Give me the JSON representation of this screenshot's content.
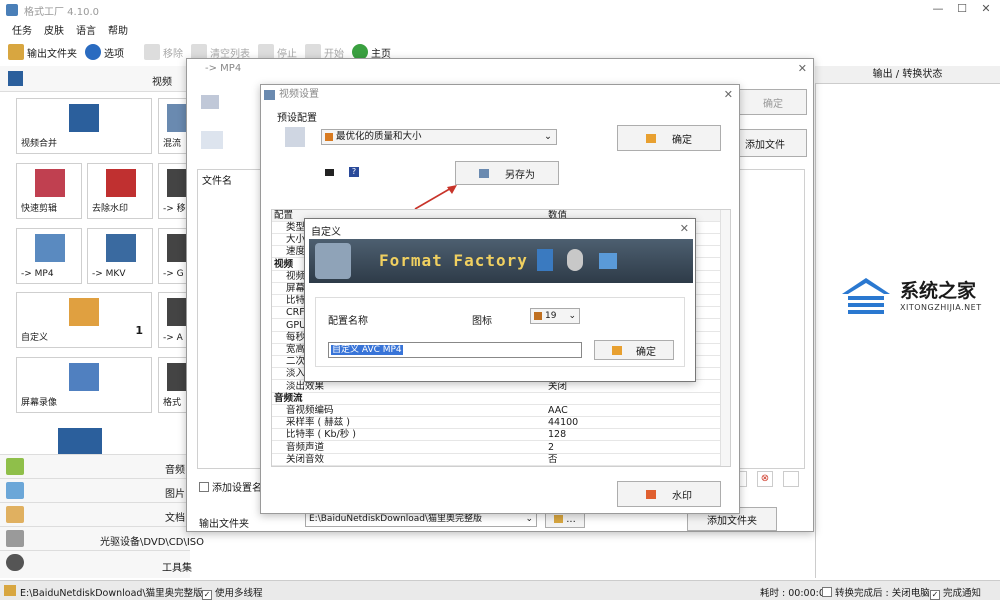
{
  "window": {
    "title": "格式工厂 4.10.0"
  },
  "menu": [
    "任务",
    "皮肤",
    "语言",
    "帮助"
  ],
  "toolbar": {
    "output_folder": "输出文件夹",
    "options": "选项",
    "remove": "移除",
    "clear_list": "清空列表",
    "stop": "停止",
    "start": "开始",
    "home": "主页"
  },
  "left_panel": {
    "header": "视频",
    "tiles": [
      {
        "label": "视频合并",
        "icon": "film-merge-icon"
      },
      {
        "label": "混流",
        "icon": "mux-icon"
      },
      {
        "label": "快速剪辑",
        "icon": "scissors-icon"
      },
      {
        "label": "去除水印",
        "icon": "eraser-icon"
      },
      {
        "label": "-> 移",
        "icon": "convert-icon"
      },
      {
        "label": "-> MP4",
        "icon": "mp4-file-icon"
      },
      {
        "label": "-> MKV",
        "icon": "mkv-file-icon"
      },
      {
        "label": "-> G",
        "icon": "convert-icon"
      },
      {
        "label": "自定义",
        "icon": "custom-icon",
        "badge": "1"
      },
      {
        "label": "-> A",
        "icon": "convert-icon"
      },
      {
        "label": "屏幕录像",
        "icon": "screen-record-icon"
      },
      {
        "label": "格式",
        "icon": "format-icon"
      }
    ],
    "categories": [
      "音频",
      "图片",
      "文档",
      "光驱设备\\DVD\\CD\\ISO",
      "工具集"
    ]
  },
  "right_panel": {
    "header": "输出 / 转换状态"
  },
  "status_bar": {
    "path": "E:\\BaiduNetdiskDownload\\猫里奥完整版",
    "multithread": "使用多线程",
    "elapsed": "耗时 : 00:00:00",
    "after_done": "转换完成后 : 关闭电脑",
    "notify": "完成通知"
  },
  "mp4_dialog": {
    "title": "-> MP4",
    "confirm": "确定",
    "add_file": "添加文件",
    "file_name_col": "文件名",
    "add_setting_name": "添加设置名",
    "output_folder_label": "输出文件夹",
    "output_path": "E:\\BaiduNetdiskDownload\\猫里奥完整版",
    "browse": "...",
    "add_folder": "添加文件夹"
  },
  "video_settings": {
    "title": "视频设置",
    "preset_label": "预设配置",
    "preset_value": "最优化的质量和大小",
    "confirm": "确定",
    "save_as": "另存为",
    "table_header": {
      "key": "配置",
      "value": "数值"
    },
    "rows": [
      {
        "k": "类型",
        "v": "",
        "sec": false
      },
      {
        "k": "大小限",
        "v": "",
        "sec": false
      },
      {
        "k": "速度",
        "v": "",
        "sec": false
      },
      {
        "k": "视频",
        "v": "",
        "sec": true
      },
      {
        "k": "视频",
        "v": "",
        "sec": false
      },
      {
        "k": "屏幕",
        "v": "",
        "sec": false
      },
      {
        "k": "比特",
        "v": "",
        "sec": false
      },
      {
        "k": "CRF",
        "v": "",
        "sec": false
      },
      {
        "k": "GPU",
        "v": "",
        "sec": false
      },
      {
        "k": "每秒",
        "v": "",
        "sec": false
      },
      {
        "k": "宽高",
        "v": "",
        "sec": false
      },
      {
        "k": "二次",
        "v": "",
        "sec": false
      },
      {
        "k": "淡入",
        "v": "",
        "sec": false
      },
      {
        "k": "淡出效果",
        "v": "关闭",
        "sec": false
      },
      {
        "k": "音频流",
        "v": "",
        "sec": true
      },
      {
        "k": "音视频编码",
        "v": "AAC",
        "sec": false
      },
      {
        "k": "采样率 ( 赫兹 )",
        "v": "44100",
        "sec": false
      },
      {
        "k": "比特率 ( Kb/秒 )",
        "v": "128",
        "sec": false
      },
      {
        "k": "音频声道",
        "v": "2",
        "sec": false
      },
      {
        "k": "关闭音效",
        "v": "否",
        "sec": false
      }
    ],
    "watermark_btn": "水印"
  },
  "custom_dialog": {
    "title": "自定义",
    "banner_text": "Format Factory",
    "config_name_label": "配置名称",
    "icon_label": "图标",
    "icon_value": "19",
    "name_value": "自定义 AVC MP4",
    "confirm": "确定"
  },
  "brand": {
    "name": "系统之家",
    "url": "XITONGZHIJIA.NET"
  },
  "colors": {
    "accent_blue": "#2a78d0",
    "selection": "#3874d8",
    "arrow_red": "#c8342a",
    "banner_dark": "#3a4a5a"
  }
}
